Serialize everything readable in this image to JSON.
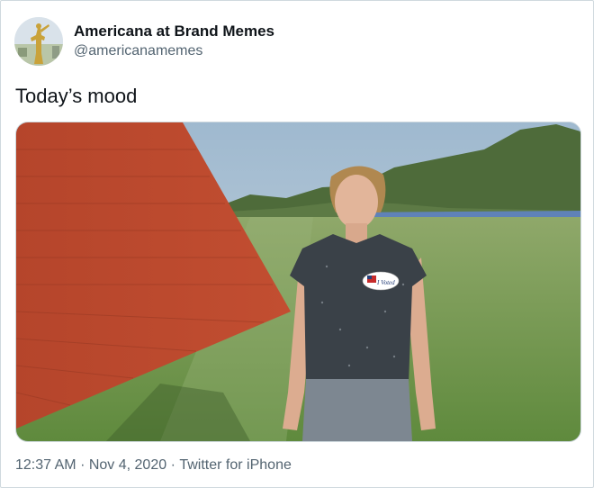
{
  "tweet": {
    "author": {
      "display_name": "Americana at Brand Memes",
      "handle": "@americanamemes",
      "avatar_icon": "golden-statue-avatar"
    },
    "text": "Today’s mood",
    "media": {
      "image_icon": "photo-woman-field-voted-sticker",
      "sticker_text": "I Voted"
    },
    "meta": {
      "time": "12:37 AM",
      "separator1": "·",
      "date": "Nov 4, 2020",
      "separator2": "·",
      "source": "Twitter for iPhone"
    }
  },
  "colors": {
    "text_primary": "#0f1419",
    "text_secondary": "#536471",
    "border": "#cfd9de"
  }
}
